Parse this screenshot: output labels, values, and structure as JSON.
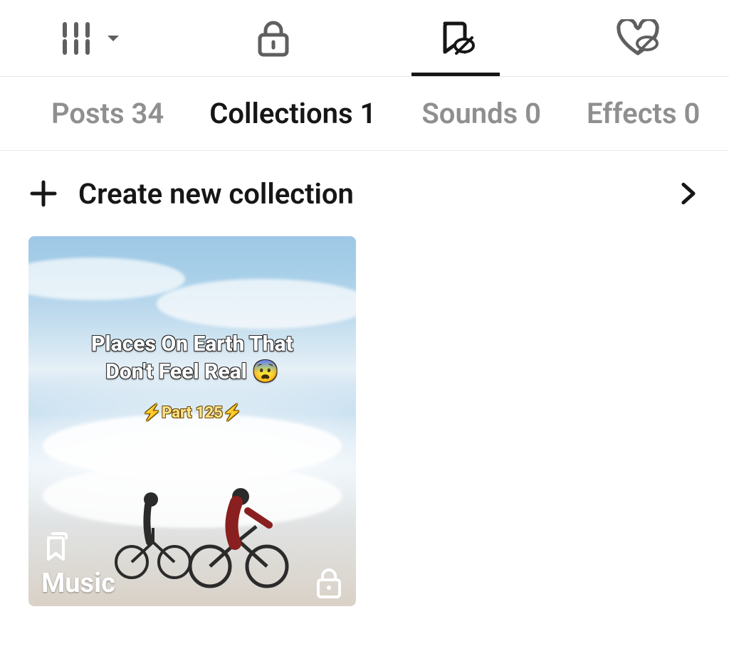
{
  "icon_tabs": {
    "grid": {
      "name": "grid-icon",
      "active": false
    },
    "private": {
      "name": "lock-icon",
      "active": false
    },
    "saved": {
      "name": "bookmark-icon",
      "active": true
    },
    "liked": {
      "name": "heart-icon",
      "active": false
    }
  },
  "label_tabs": [
    {
      "key": "posts",
      "label": "Posts 34",
      "active": false
    },
    {
      "key": "collections",
      "label": "Collections 1",
      "active": true
    },
    {
      "key": "sounds",
      "label": "Sounds 0",
      "active": false
    },
    {
      "key": "effects",
      "label": "Effects 0",
      "active": false
    }
  ],
  "create_row": {
    "label": "Create new collection"
  },
  "collections": [
    {
      "title": "Music",
      "private": true,
      "thumbnail_overlay": {
        "line1": "Places On Earth That",
        "line2": "Don't Feel Real 😨",
        "sub": "⚡Part 125⚡"
      }
    }
  ]
}
